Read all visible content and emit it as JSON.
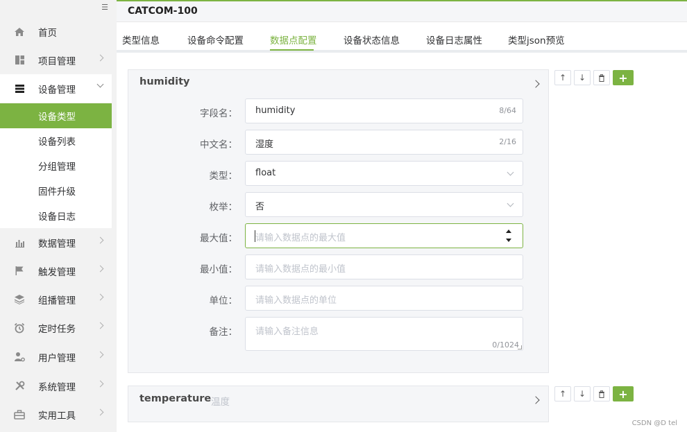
{
  "sidebar": {
    "items": [
      {
        "label": "首页",
        "icon": "home-icon"
      },
      {
        "label": "项目管理",
        "icon": "dashboard-icon"
      },
      {
        "label": "设备管理",
        "icon": "server-icon"
      },
      {
        "label": "数据管理",
        "icon": "bar-chart-icon"
      },
      {
        "label": "触发管理",
        "icon": "flag-icon"
      },
      {
        "label": "组播管理",
        "icon": "layers-icon"
      },
      {
        "label": "定时任务",
        "icon": "alarm-clock-icon"
      },
      {
        "label": "用户管理",
        "icon": "user-gear-icon"
      },
      {
        "label": "系统管理",
        "icon": "tools-icon"
      },
      {
        "label": "实用工具",
        "icon": "toolbox-icon"
      }
    ],
    "sub_items": [
      {
        "label": "设备类型"
      },
      {
        "label": "设备列表"
      },
      {
        "label": "分组管理"
      },
      {
        "label": "固件升级"
      },
      {
        "label": "设备日志"
      }
    ]
  },
  "header": {
    "title": "CATCOM-100"
  },
  "tabs": [
    {
      "label": "类型信息"
    },
    {
      "label": "设备命令配置"
    },
    {
      "label": "数据点配置"
    },
    {
      "label": "设备状态信息"
    },
    {
      "label": "设备日志属性"
    },
    {
      "label": "类型json预览"
    }
  ],
  "panel1": {
    "title": "humidity",
    "form": {
      "field_name": {
        "label": "字段名：",
        "value": "humidity",
        "count": "8/64"
      },
      "cn_name": {
        "label": "中文名：",
        "value": "湿度",
        "count": "2/16"
      },
      "type": {
        "label": "类型：",
        "value": "float"
      },
      "enum": {
        "label": "枚举：",
        "value": "否"
      },
      "max": {
        "label": "最大值：",
        "placeholder": "请输入数据点的最大值"
      },
      "min": {
        "label": "最小值：",
        "placeholder": "请输入数据点的最小值"
      },
      "unit": {
        "label": "单位：",
        "placeholder": "请输入数据点的单位"
      },
      "remark": {
        "label": "备注：",
        "placeholder": "请输入备注信息",
        "count": "0/1024"
      }
    }
  },
  "panel2": {
    "title": "temperature",
    "subtitle": "温度"
  },
  "actions": {
    "up": "↑",
    "down": "↓",
    "add": "+"
  },
  "watermark": "CSDN @D tel",
  "colors": {
    "accent": "#7cb342",
    "sidebar_bg": "#f2f2f2",
    "panel_bg": "#f5f6f8"
  }
}
